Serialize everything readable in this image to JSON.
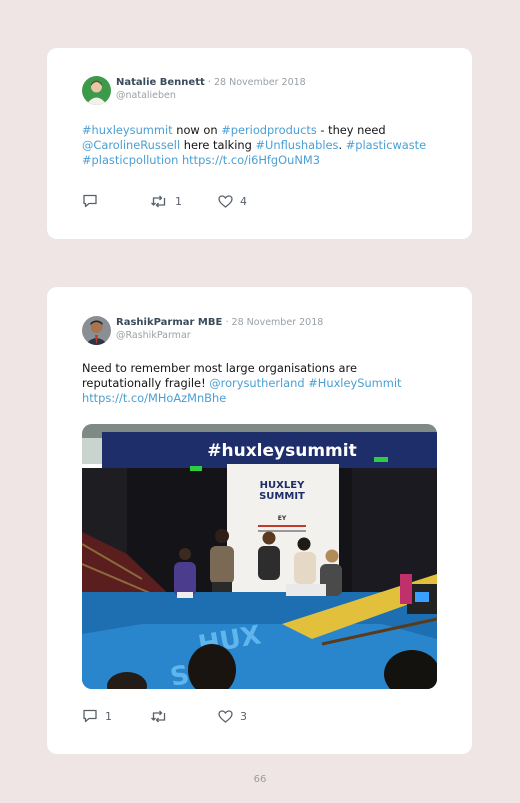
{
  "tweets": [
    {
      "author": "Natalie Bennett",
      "date": "· 28 November 2018",
      "handle": "@natalieben",
      "text_parts": {
        "t1": "#huxleysummit",
        "t2": " now on ",
        "t3": "#periodproducts",
        "t4": " - they need ",
        "t5": "@CarolineRussell",
        "t6": " here talking ",
        "t7": "#Unflushables",
        "t8": ". ",
        "t9": "#plasticwaste",
        "t10": " ",
        "t11": "#plasticpollution",
        "t12": " ",
        "t13": "https://t.co/i6HfgOuNM3"
      },
      "reply_count": "",
      "retweet_count": "1",
      "like_count": "4",
      "icons": [
        "reply-icon",
        "retweet-icon",
        "like-icon"
      ]
    },
    {
      "author": "RashikParmar MBE",
      "date": "· 28 November 2018",
      "handle": "@RashikParmar",
      "text_parts": {
        "t1": "Need to remember most large organisations are reputationally fragile! ",
        "t2": "@rorysutherland",
        "t3": " ",
        "t4": "#HuxleySummit",
        "t5": " ",
        "t6": "https://t.co/MHoAzMnBhe"
      },
      "photo": {
        "banner": "#huxleysummit",
        "logo_line1": "HUXLEY",
        "logo_line2": "SUMMIT",
        "sponsor": "EY",
        "floor_text_1": "HUX",
        "floor_text_2": "SUM"
      },
      "reply_count": "1",
      "retweet_count": "",
      "like_count": "3",
      "icons": [
        "reply-icon",
        "retweet-icon",
        "like-icon"
      ]
    }
  ],
  "page_number": "66",
  "colors": {
    "link": "#4a9fd4",
    "name": "#3a4a5c",
    "meta": "#9aa0a6",
    "background": "#efe5e5"
  }
}
